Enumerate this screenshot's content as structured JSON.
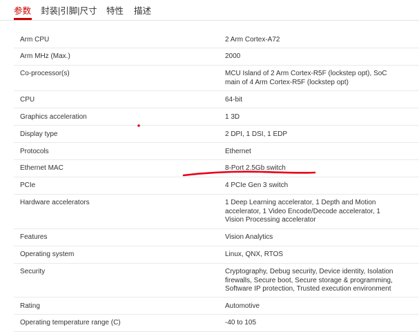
{
  "tabs": [
    {
      "label": "参数",
      "active": true
    },
    {
      "label": "封装|引脚|尺寸",
      "active": false
    },
    {
      "label": "特性",
      "active": false
    },
    {
      "label": "描述",
      "active": false
    }
  ],
  "accent_color": "#cc0000",
  "annotation_color": "#e8001c",
  "specs": [
    {
      "label": "Arm CPU",
      "value": "2 Arm Cortex-A72"
    },
    {
      "label": "Arm MHz (Max.)",
      "value": "2000"
    },
    {
      "label": "Co-processor(s)",
      "value": "MCU Island of 2 Arm Cortex-R5F (lockstep opt), SoC main of 4 Arm Cortex-R5F (lockstep opt)"
    },
    {
      "label": "CPU",
      "value": "64-bit"
    },
    {
      "label": "Graphics acceleration",
      "value": "1 3D"
    },
    {
      "label": "Display type",
      "value": "2 DPI, 1 DSI, 1 EDP"
    },
    {
      "label": "Protocols",
      "value": "Ethernet"
    },
    {
      "label": "Ethernet MAC",
      "value": "8-Port 2.5Gb switch"
    },
    {
      "label": "PCIe",
      "value": "4 PCIe Gen 3 switch"
    },
    {
      "label": "Hardware accelerators",
      "value": "1 Deep Learning accelerator, 1 Depth and Motion accelerator, 1 Video Encode/Decode accelerator, 1 Vision Processing accelerator"
    },
    {
      "label": "Features",
      "value": "Vision Analytics"
    },
    {
      "label": "Operating system",
      "value": "Linux, QNX, RTOS"
    },
    {
      "label": "Security",
      "value": "Cryptography, Debug security, Device identity, Isolation firewalls, Secure boot, Secure storage & programming, Software IP protection, Trusted execution environment"
    },
    {
      "label": "Rating",
      "value": "Automotive"
    },
    {
      "label": "Operating temperature range (C)",
      "value": "-40 to 105"
    }
  ]
}
